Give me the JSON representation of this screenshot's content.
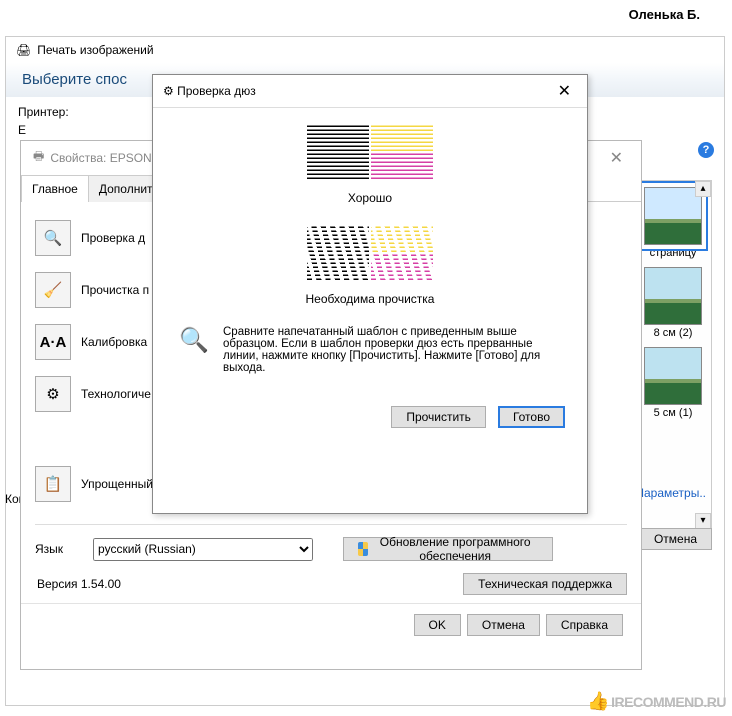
{
  "user": "Оленька Б.",
  "print": {
    "title": "Печать изображений",
    "band": "Выберите спос",
    "printerLabel": "Принтер:",
    "e": "Е"
  },
  "props": {
    "title": "Свойства: EPSON",
    "tabs": {
      "main": "Главное",
      "advanced": "Дополните"
    },
    "items": {
      "nozzle": "Проверка д",
      "cleaning": "Прочистка п",
      "calibration": "Калибровка",
      "tech": "Технологиче",
      "simple": "Упрощенный"
    },
    "langLabel": "Язык",
    "langValue": "русский (Russian)",
    "updateBtn": "Обновление программного обеспечения",
    "version": "Версия 1.54.00",
    "support": "Техническая поддержка",
    "ok": "OK",
    "cancel": "Отмена",
    "help": "Справка"
  },
  "nozzle": {
    "title": "Проверка дюз",
    "goodLabel": "Хорошо",
    "badLabel": "Необходима прочистка",
    "msg": "Сравните напечатанный шаблон с приведенным выше образцом. Если в шаблон проверки дюз есть прерванные линии, нажмите кнопку [Прочистить]. Нажмите [Готово] для выхода.",
    "clean": "Прочистить",
    "done": "Готово"
  },
  "thumbs": {
    "t1": "страницу",
    "t2": "8 см (2)",
    "t3": "5 см (1)"
  },
  "kop": "Коп",
  "paramsLink": "Параметры..",
  "cancel": "Отмена",
  "watermark": "IRECOMMEND.RU"
}
